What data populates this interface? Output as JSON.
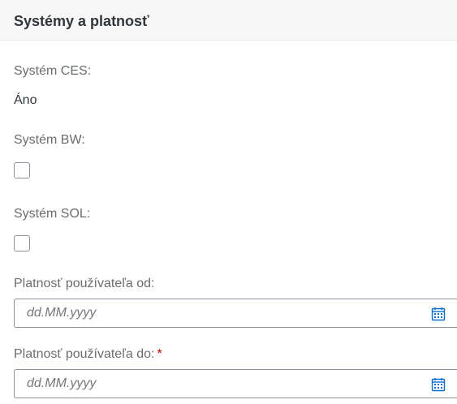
{
  "section": {
    "title": "Systémy a platnosť"
  },
  "fields": {
    "ces": {
      "label": "Systém CES:",
      "value": "Áno"
    },
    "bw": {
      "label": "Systém BW:",
      "checked": false
    },
    "sol": {
      "label": "Systém SOL:",
      "checked": false
    },
    "valid_from": {
      "label": "Platnosť používateľa od:",
      "placeholder": "dd.MM.yyyy"
    },
    "valid_to": {
      "label": "Platnosť používateľa do:",
      "required_mark": "*",
      "placeholder": "dd.MM.yyyy"
    }
  },
  "icons": {
    "calendar": "calendar-icon"
  },
  "colors": {
    "accent": "#0a6ed1",
    "required": "#bb0000",
    "label": "#6a6d70",
    "border": "#89919a"
  }
}
